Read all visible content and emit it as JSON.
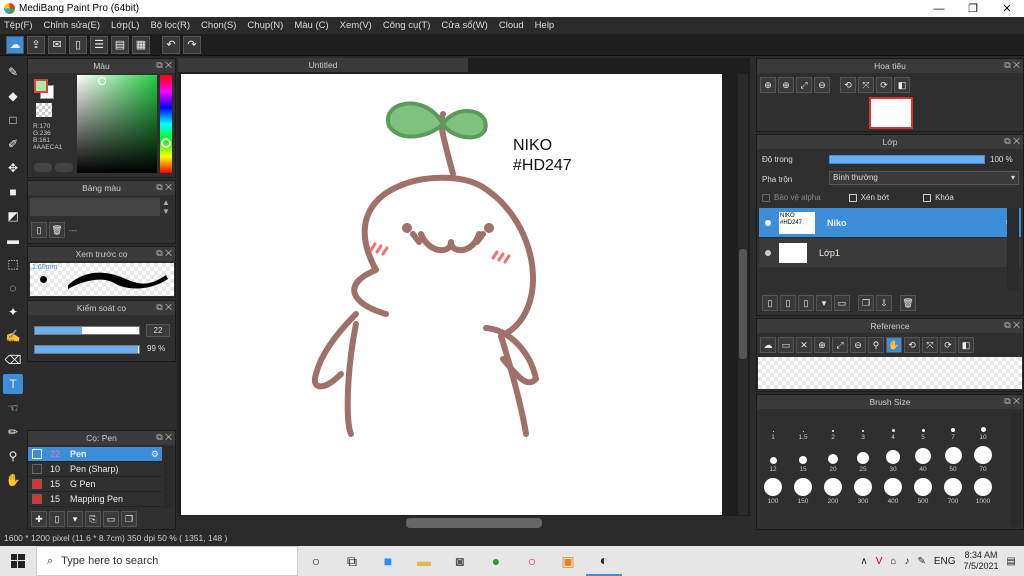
{
  "window": {
    "title": "MediBang Paint Pro (64bit)",
    "minimize": "—",
    "maximize": "❐",
    "close": "✕"
  },
  "menu": [
    "Tệp(F)",
    "Chỉnh sửa(E)",
    "Lớp(L)",
    "Bộ lọc(R)",
    "Chọn(S)",
    "Chụp(N)",
    "Màu (C)",
    "Xem(V)",
    "Công cụ(T)",
    "Cửa sổ(W)",
    "Cloud",
    "Help"
  ],
  "toolbar_icons": [
    "cloud-icon",
    "share-icon",
    "comment-icon",
    "page-icon",
    "page-settings-icon",
    "panel-icon",
    "grid-icon",
    "undo-icon",
    "redo-icon"
  ],
  "color_panel": {
    "title": "Màu",
    "rgb": {
      "r": "R:170",
      "g": "G:236",
      "b": "B:161"
    },
    "hex": "#AAECA1",
    "primary_color": "#AAECA1",
    "secondary_color": "#ffffff"
  },
  "palette_panel": {
    "title": "Bảng màu",
    "dash": "---"
  },
  "brush_preview": {
    "title": "Xem trước cọ",
    "size": "1.60mm"
  },
  "brush_control": {
    "title": "Kiểm soát cọ",
    "size_value": "22",
    "opacity_value": "99 %",
    "size_fraction": 0.45,
    "opacity_fraction": 0.99
  },
  "brush_list": {
    "title": "Cọ: Pen",
    "items": [
      {
        "size": "22",
        "name": "Pen",
        "color": "#3d8ed8",
        "selected": true
      },
      {
        "size": "10",
        "name": "Pen (Sharp)",
        "color": "#333333",
        "selected": false
      },
      {
        "size": "15",
        "name": "G Pen",
        "color": "#e03030",
        "selected": false
      },
      {
        "size": "15",
        "name": "Mapping Pen",
        "color": "#e03030",
        "selected": false
      }
    ]
  },
  "document": {
    "tab": "Untitled",
    "status": "1600 * 1200 pixel   (11.6 * 8.7cm)   350 dpi   50 %   ( 1351, 148 )"
  },
  "artwork": {
    "text_line1": "NIKO",
    "text_line2": "#HD247"
  },
  "navigator": {
    "title": "Hoa tiêu"
  },
  "layers_panel": {
    "title": "Lớp",
    "opacity_label": "Độ trong",
    "opacity_value": "100 %",
    "opacity_fraction": 1.0,
    "blend_label": "Pha trộn",
    "blend_value": "Bình thường",
    "protect_alpha": "Bảo vệ alpha",
    "clipping": "Xén bớt",
    "lock": "Khóa",
    "layers": [
      {
        "name": "Niko",
        "selected": true,
        "thumb_text": "NIKO #HD247"
      },
      {
        "name": "Lớp1",
        "selected": false,
        "thumb_text": ""
      }
    ]
  },
  "reference": {
    "title": "Reference"
  },
  "brush_size": {
    "title": "Brush Size",
    "sizes": [
      "1",
      "1.5",
      "2",
      "3",
      "4",
      "5",
      "7",
      "10",
      "12",
      "15",
      "20",
      "25",
      "30",
      "40",
      "50",
      "70",
      "100",
      "150",
      "200",
      "300",
      "400",
      "500",
      "700",
      "1000"
    ]
  },
  "taskbar": {
    "search_placeholder": "Type here to search",
    "language": "ENG",
    "time": "8:34 AM",
    "date": "7/5/2021"
  }
}
